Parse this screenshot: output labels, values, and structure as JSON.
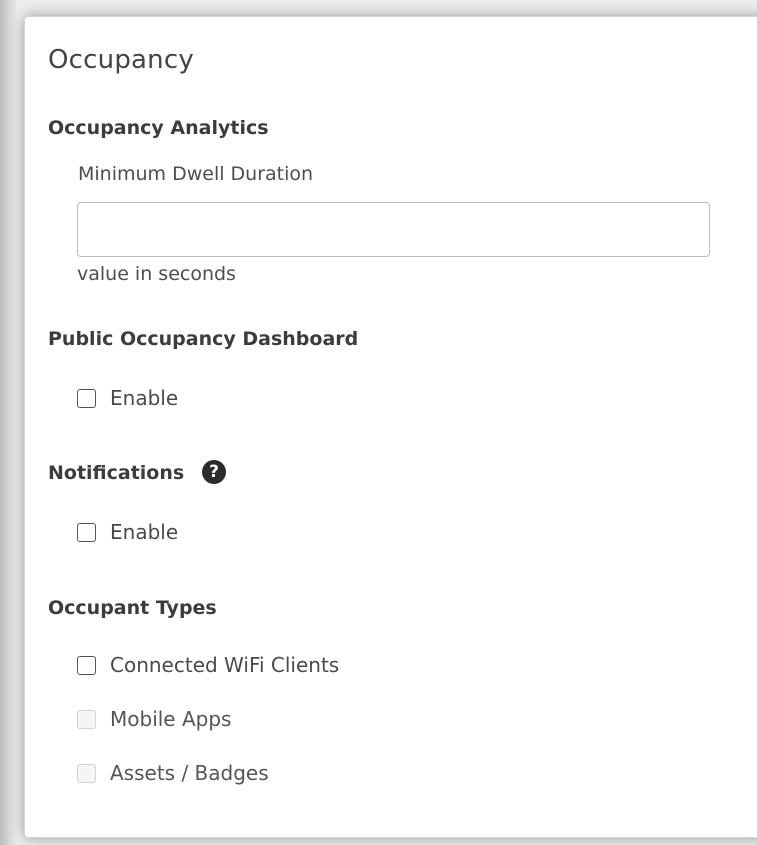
{
  "panel": {
    "title": "Occupancy"
  },
  "occupancy_analytics": {
    "heading": "Occupancy Analytics",
    "min_dwell_label": "Minimum Dwell Duration",
    "min_dwell_value": "",
    "min_dwell_placeholder": "",
    "min_dwell_help": "value in seconds"
  },
  "public_dashboard": {
    "heading": "Public Occupancy Dashboard",
    "enable_label": "Enable",
    "enabled": false
  },
  "notifications": {
    "heading": "Notifications",
    "help_icon": "question-circle-icon",
    "help_glyph": "?",
    "enable_label": "Enable",
    "enabled": false
  },
  "occupant_types": {
    "heading": "Occupant Types",
    "options": [
      {
        "label": "Connected WiFi Clients",
        "checked": false,
        "disabled": false
      },
      {
        "label": "Mobile Apps",
        "checked": false,
        "disabled": true
      },
      {
        "label": "Assets / Badges",
        "checked": false,
        "disabled": true
      }
    ]
  }
}
